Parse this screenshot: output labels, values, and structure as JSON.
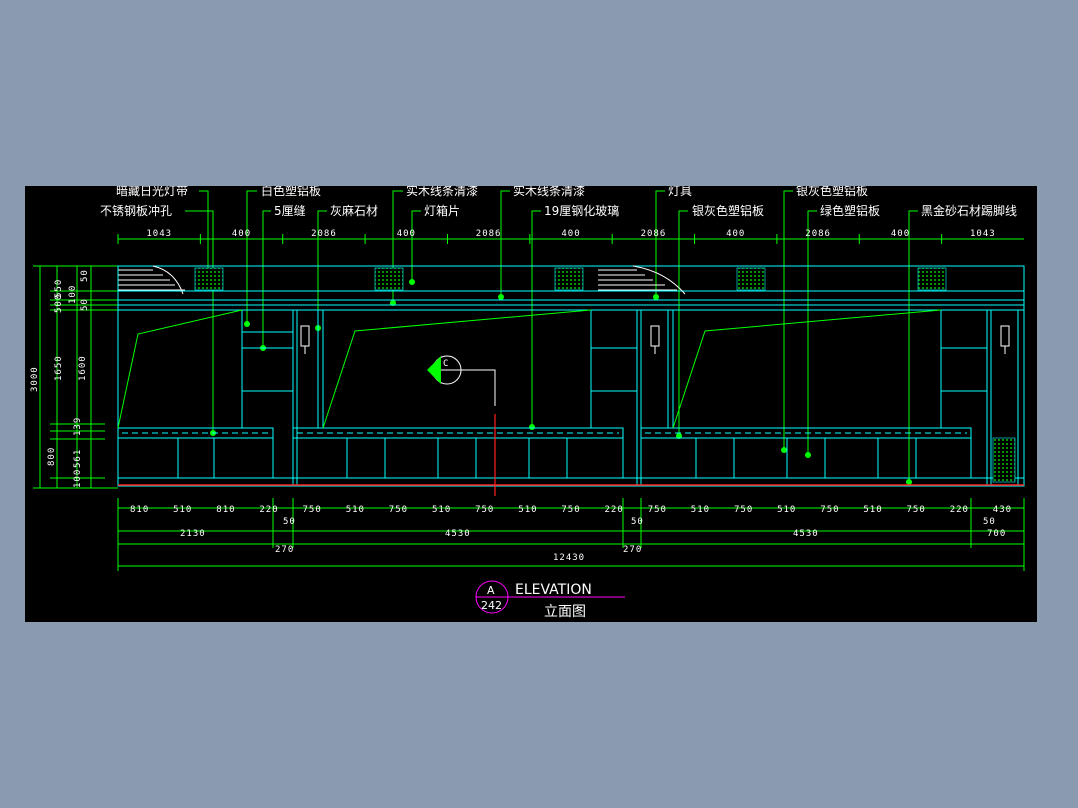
{
  "labels_top_row": [
    "暗藏日光灯带",
    "白色塑铝板",
    "实木线条清漆",
    "实木线条清漆",
    "灯具",
    "银灰色塑铝板"
  ],
  "labels_second_row": [
    "不锈钢板冲孔",
    "5厘缝",
    "灰麻石材",
    "灯箱片",
    "19厘钢化玻璃",
    "银灰色塑铝板",
    "绿色塑铝板",
    "黑金砂石材踢脚线"
  ],
  "dims_top": [
    "1043",
    "400",
    "2086",
    "400",
    "2086",
    "400",
    "2086",
    "400",
    "2086",
    "400",
    "1043"
  ],
  "dims_left_outer": [
    "3000",
    "800"
  ],
  "dims_left_inner": [
    "550",
    "500",
    "100",
    "50",
    "50",
    "1650",
    "1600",
    "139",
    "561",
    "100"
  ],
  "dims_bottom_row1": [
    "810",
    "510",
    "810",
    "220",
    "750",
    "510",
    "750",
    "510",
    "750",
    "510",
    "750",
    "220",
    "750",
    "510",
    "750",
    "510",
    "750",
    "510",
    "750",
    "220",
    "430"
  ],
  "dims_bottom_small": [
    "50",
    "50",
    "50"
  ],
  "dims_bottom_row2": [
    "2130",
    "4530",
    "4530",
    "700"
  ],
  "dims_bottom_row3": [
    "270",
    "270"
  ],
  "dims_total": "12430",
  "section_marker": "C",
  "title": {
    "symbol_top": "A",
    "symbol_bottom": "242",
    "en": "ELEVATION",
    "cn": "立面图"
  }
}
